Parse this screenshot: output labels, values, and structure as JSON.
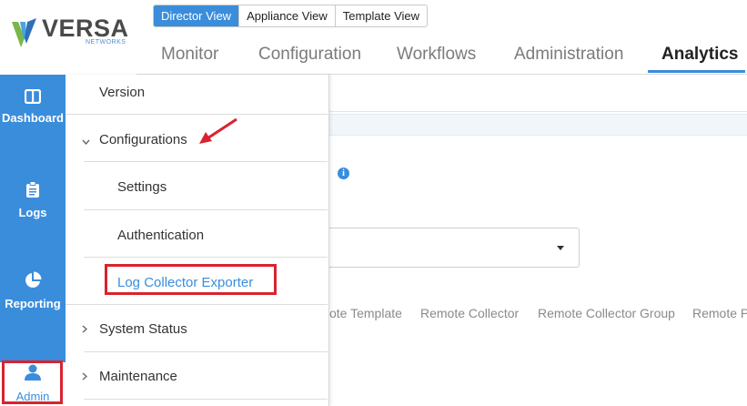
{
  "brand": {
    "name": "VERSA",
    "tagline": "NETWORKS"
  },
  "view_switch": [
    {
      "label": "Director View",
      "active": true
    },
    {
      "label": "Appliance View",
      "active": false
    },
    {
      "label": "Template View",
      "active": false
    }
  ],
  "topnav": [
    {
      "label": "Monitor",
      "active": false
    },
    {
      "label": "Configuration",
      "active": false
    },
    {
      "label": "Workflows",
      "active": false
    },
    {
      "label": "Administration",
      "active": false
    },
    {
      "label": "Analytics",
      "active": true
    }
  ],
  "sidebar": [
    {
      "label": "Dashboard",
      "icon": "dashboard-icon"
    },
    {
      "label": "Logs",
      "icon": "clipboard-icon"
    },
    {
      "label": "Reporting",
      "icon": "pie-chart-icon"
    },
    {
      "label": "Admin",
      "icon": "user-icon",
      "active": true
    }
  ],
  "admin_menu": {
    "version": "Version",
    "configurations": "Configurations",
    "settings": "Settings",
    "authentication": "Authentication",
    "log_collector_exporter": "Log Collector Exporter",
    "system_status": "System Status",
    "maintenance": "Maintenance"
  },
  "content_tabs": [
    "ote Template",
    "Remote Collector",
    "Remote Collector Group",
    "Remote P"
  ],
  "colors": {
    "accent": "#3a8ddb",
    "highlight": "#d9232e"
  }
}
